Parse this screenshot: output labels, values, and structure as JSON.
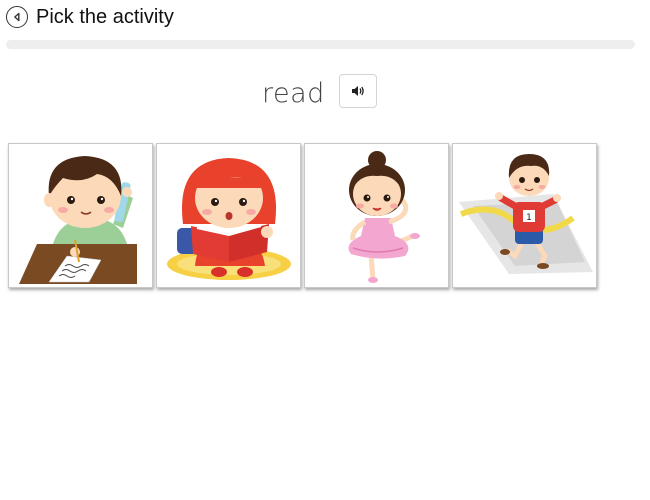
{
  "header": {
    "title": "Pick the activity",
    "back_icon": "back-arrow-icon"
  },
  "progress": {
    "fraction": 0.0
  },
  "prompt": {
    "word": "read",
    "audio_icon": "speaker-icon"
  },
  "choices": [
    {
      "id": "write",
      "image": "boy-writing-at-desk"
    },
    {
      "id": "read",
      "image": "girl-reading-book"
    },
    {
      "id": "dance",
      "image": "girl-ballet-dancing"
    },
    {
      "id": "run",
      "image": "boy-running-finish-line"
    }
  ],
  "colors": {
    "hair_brown": "#4a2a17",
    "hair_red": "#e8412c",
    "skin": "#fcd9b8",
    "book_red": "#e23b33",
    "dress_pink": "#f3a6cf",
    "shirt_green": "#9ccf98",
    "runner_red": "#e03a34",
    "ribbon_yellow": "#f2d94a"
  }
}
